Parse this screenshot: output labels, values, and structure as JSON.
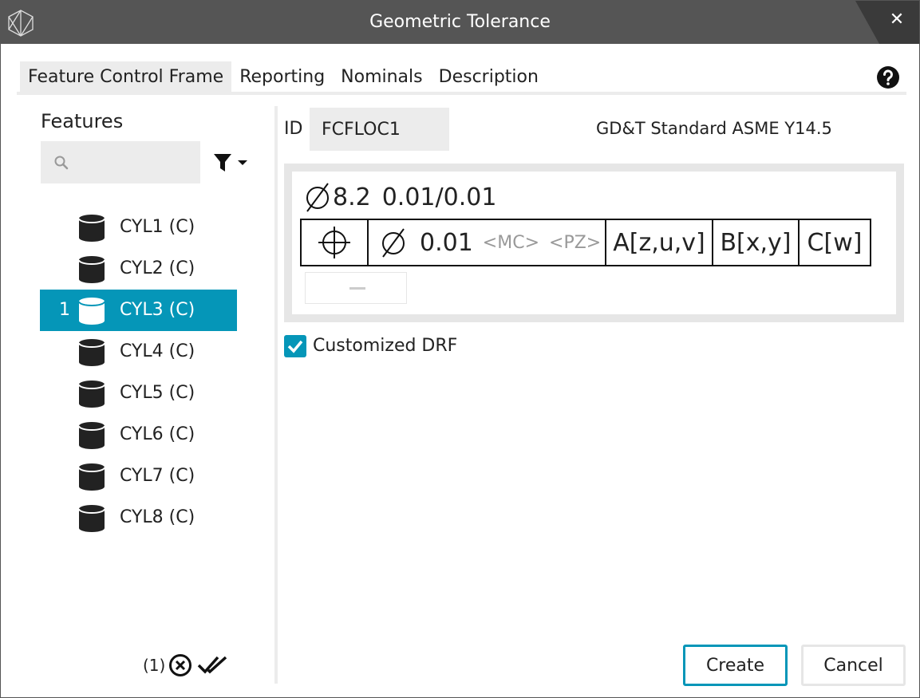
{
  "window": {
    "title": "Geometric Tolerance",
    "close_label": "✕"
  },
  "tabs": [
    {
      "label": "Feature Control Frame",
      "active": true
    },
    {
      "label": "Reporting",
      "active": false
    },
    {
      "label": "Nominals",
      "active": false
    },
    {
      "label": "Description",
      "active": false
    }
  ],
  "features_panel": {
    "title": "Features",
    "search_value": "",
    "items": [
      {
        "index": "",
        "label": "CYL1 (C)",
        "selected": false
      },
      {
        "index": "",
        "label": "CYL2 (C)",
        "selected": false
      },
      {
        "index": "1",
        "label": "CYL3 (C)",
        "selected": true
      },
      {
        "index": "",
        "label": "CYL4 (C)",
        "selected": false
      },
      {
        "index": "",
        "label": "CYL5 (C)",
        "selected": false
      },
      {
        "index": "",
        "label": "CYL6 (C)",
        "selected": false
      },
      {
        "index": "",
        "label": "CYL7 (C)",
        "selected": false
      },
      {
        "index": "",
        "label": "CYL8 (C)",
        "selected": false
      }
    ],
    "selection_count": "(1)"
  },
  "id_field": {
    "label": "ID",
    "value": "FCFLOC1"
  },
  "standard": "GD&T Standard ASME Y14.5",
  "fcf": {
    "size_value": "8.2",
    "size_tolerance": "0.01/0.01",
    "tolerance_value": "0.01",
    "modifier_mc": "<MC>",
    "modifier_pz": "<PZ>",
    "datums": [
      "A[z,u,v]",
      "B[x,y]",
      "C[w]"
    ]
  },
  "customized_drf": {
    "label": "Customized DRF",
    "checked": true
  },
  "buttons": {
    "create": "Create",
    "cancel": "Cancel"
  },
  "colors": {
    "accent": "#0596b8",
    "titlebar": "#555555"
  }
}
